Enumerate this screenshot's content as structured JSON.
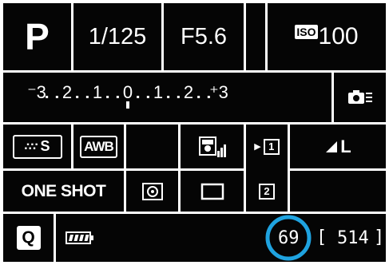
{
  "shooting_mode": "P",
  "shutter_speed": "1/125",
  "aperture": "F5.6",
  "iso": {
    "badge": "ISO",
    "value": "100"
  },
  "exposure_scale": {
    "ticks": [
      "⁻3",
      "2",
      "1",
      "0",
      "1",
      "2",
      "⁺3"
    ],
    "marker_position_stops": 0
  },
  "custom_function_icon": "camera-settings-icon",
  "picture_style": {
    "icon": "picture-style-icon",
    "value": "S"
  },
  "white_balance": "AWB",
  "auto_lighting_optimizer_icon": "auto-lighting-optimizer-icon",
  "drive_mode_icon": "single-shot-drive-icon",
  "quality": {
    "icon": "jpeg-quality-icon",
    "value": "L"
  },
  "focus_mode": "ONE SHOT",
  "metering_icon": "evaluative-metering-icon",
  "af_point_icon": "af-area-icon",
  "flash_exposure_icon": "number-2-icon",
  "flash_exposure_value": "2",
  "drive_mode_value": "1",
  "quick_control": "Q",
  "battery_level": 1.0,
  "shots_remaining": "69",
  "max_burst": "514",
  "max_burst_open": "[",
  "max_burst_close": "]",
  "highlight_color": "#1fa3e0"
}
